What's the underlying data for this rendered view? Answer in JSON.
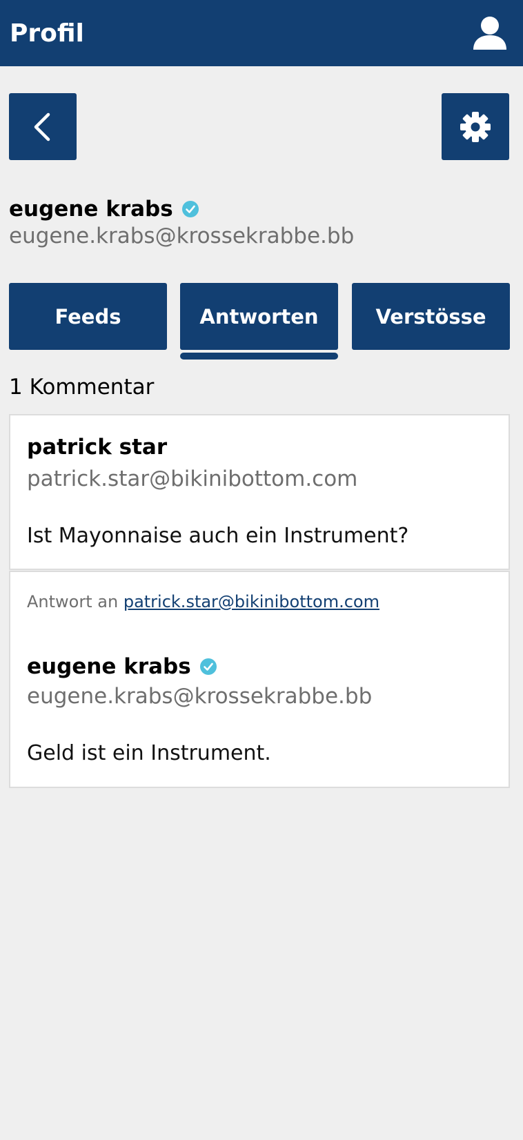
{
  "header": {
    "title": "Profil",
    "user_icon": "user-icon"
  },
  "nav": {
    "back_icon": "chevron-left-icon",
    "settings_icon": "gear-icon"
  },
  "profile": {
    "name": "eugene krabs",
    "email": "eugene.krabs@krossekrabbe.bb",
    "verified_icon": "verified-check-icon"
  },
  "tabs": [
    {
      "label": "Feeds",
      "active": false
    },
    {
      "label": "Antworten",
      "active": true
    },
    {
      "label": "Verstösse",
      "active": false
    }
  ],
  "comments": {
    "count_label": "1 Kommentar",
    "original": {
      "name": "patrick star",
      "email": "patrick.star@bikinibottom.com",
      "text": "Ist Mayonnaise auch ein Instrument?"
    },
    "reply": {
      "prefix": "Antwort an",
      "reply_to": "patrick.star@bikinibottom.com",
      "name": "eugene krabs",
      "email": "eugene.krabs@krossekrabbe.bb",
      "text": "Geld ist ein Instrument."
    }
  },
  "colors": {
    "primary": "#123f72",
    "verified": "#4fc0dc",
    "background": "#efefef"
  }
}
